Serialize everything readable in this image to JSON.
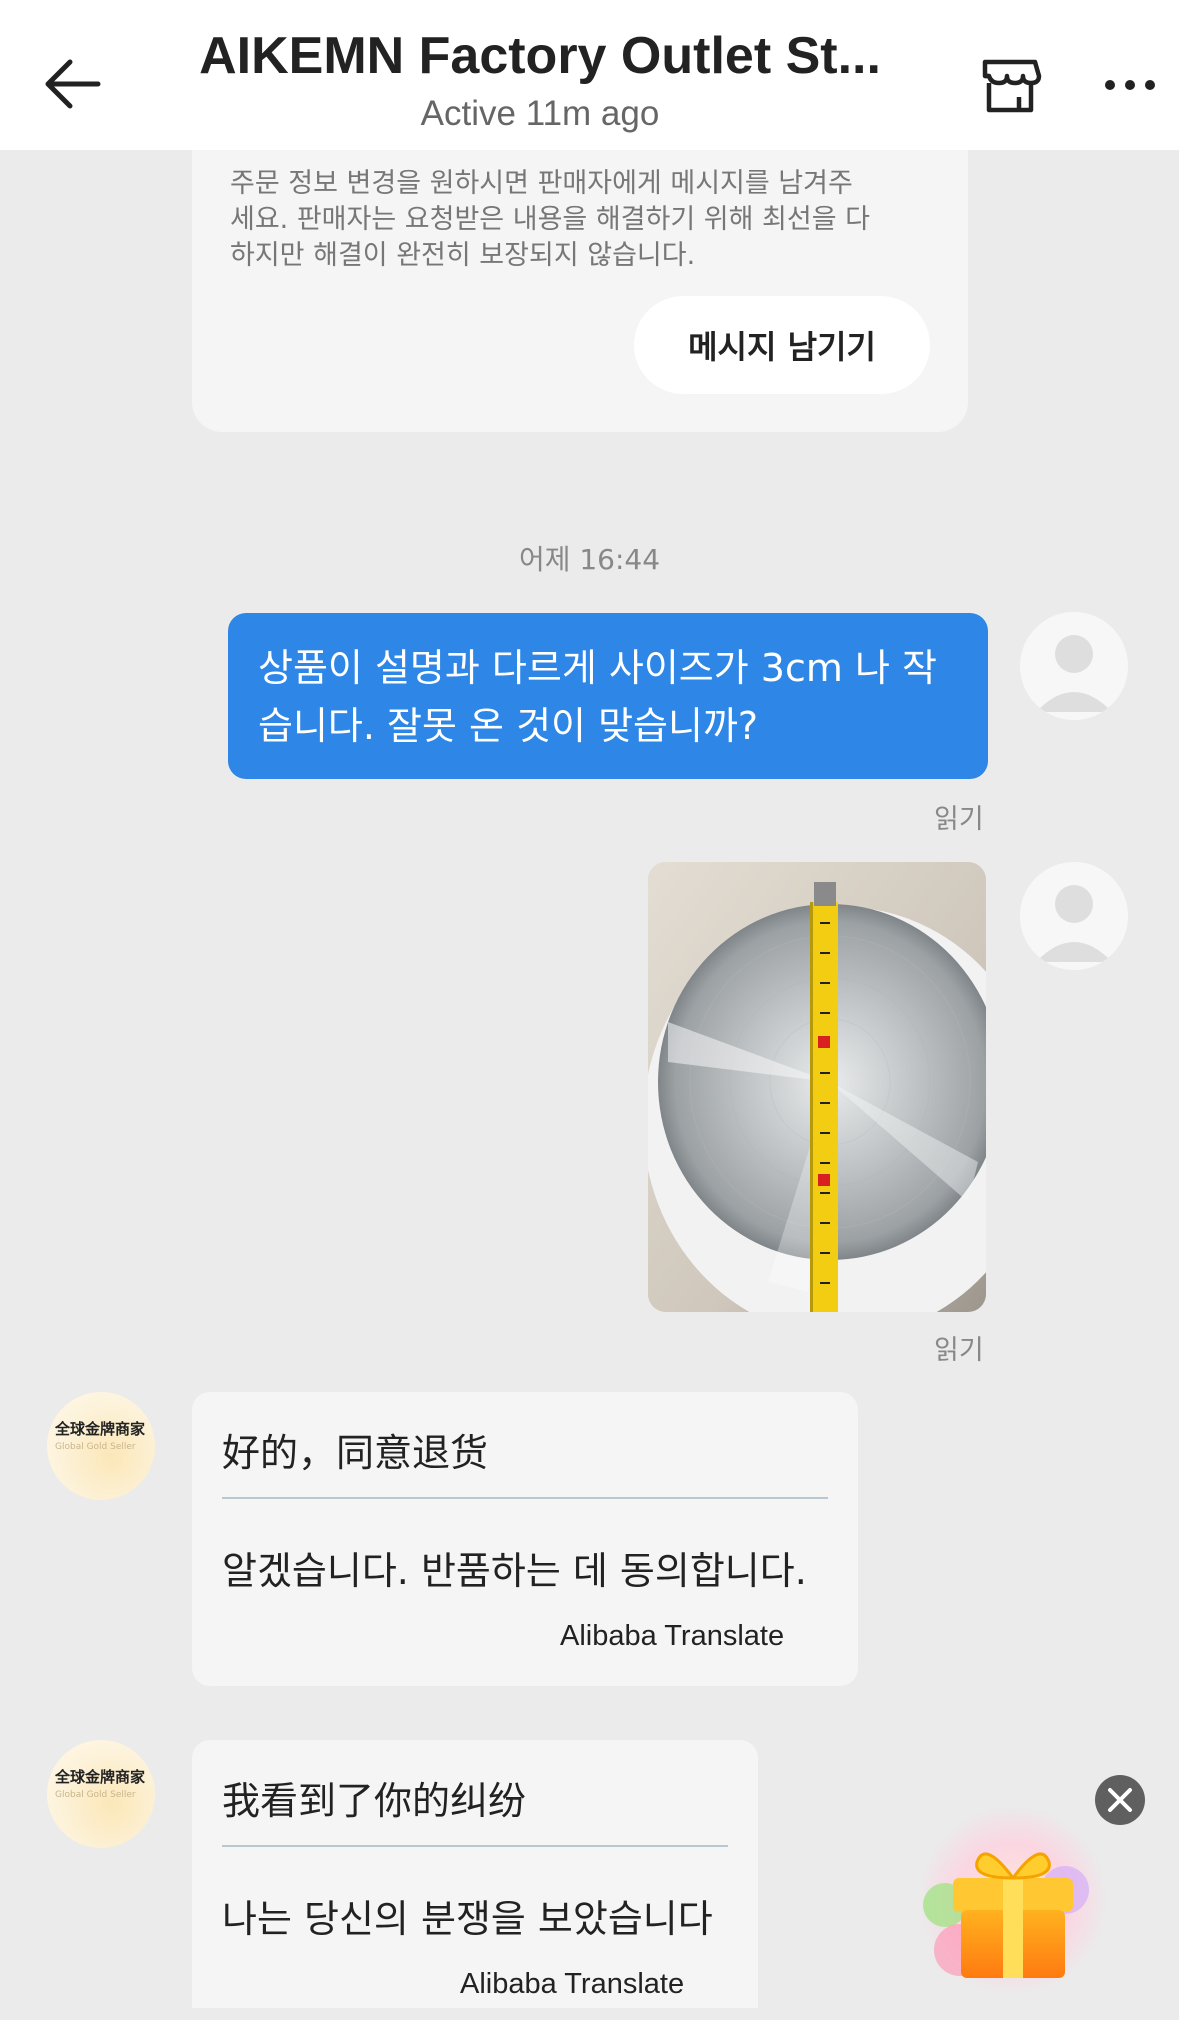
{
  "header": {
    "title": "AIKEMN Factory Outlet St...",
    "status": "Active 11m ago"
  },
  "info_card": {
    "text": "주문 정보 변경을 원하시면 판매자에게 메시지를 남겨주세요. 판매자는 요청받은 내용을 해결하기 위해 최선을 다 하지만 해결이 완전히 보장되지 않습니다.",
    "button_label": "메시지 남기기"
  },
  "timestamp": "어제 16:44",
  "messages": {
    "user_text": "상품이 설명과 다르게 사이즈가 3cm 나 작습니다. 잘못 온 것이 맞습니까?",
    "read_label_1": "읽기",
    "read_label_2": "읽기",
    "seller_avatar": {
      "label": "全球金牌商家",
      "sublabel": "Global Gold Seller"
    },
    "seller_1": {
      "original": "好的，同意退货",
      "translated": "알겠습니다. 반품하는 데 동의합니다.",
      "credit": "Alibaba Translate"
    },
    "seller_2": {
      "original": "我看到了你的纠纷",
      "translated": "나는 당신의 분쟁을 보았습니다",
      "credit": "Alibaba Translate"
    }
  },
  "colors": {
    "bubble_blue": "#2e86e6",
    "chat_background": "#ebebeb",
    "card_background": "#f5f5f5"
  }
}
